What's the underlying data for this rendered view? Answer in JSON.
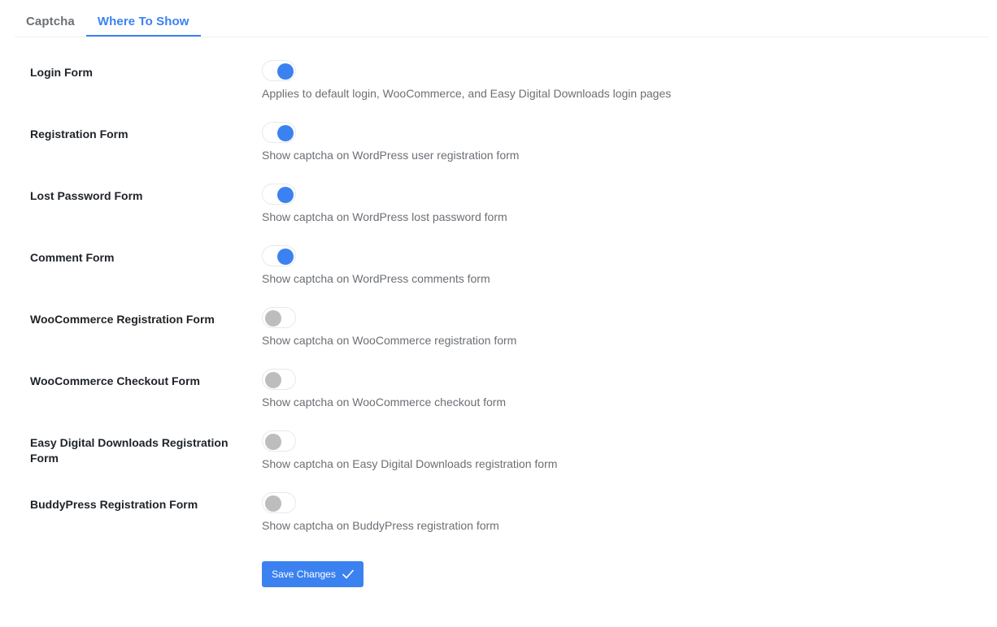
{
  "tabs": [
    {
      "label": "Captcha",
      "active": false
    },
    {
      "label": "Where To Show",
      "active": true
    }
  ],
  "settings": [
    {
      "label": "Login Form",
      "enabled": true,
      "description": "Applies to default login, WooCommerce, and Easy Digital Downloads login pages"
    },
    {
      "label": "Registration Form",
      "enabled": true,
      "description": "Show captcha on WordPress user registration form"
    },
    {
      "label": "Lost Password Form",
      "enabled": true,
      "description": "Show captcha on WordPress lost password form"
    },
    {
      "label": "Comment Form",
      "enabled": true,
      "description": "Show captcha on WordPress comments form"
    },
    {
      "label": "WooCommerce Registration Form",
      "enabled": false,
      "description": "Show captcha on WooCommerce registration form"
    },
    {
      "label": "WooCommerce Checkout Form",
      "enabled": false,
      "description": "Show captcha on WooCommerce checkout form"
    },
    {
      "label": "Easy Digital Downloads Registration Form",
      "enabled": false,
      "description": "Show captcha on Easy Digital Downloads registration form"
    },
    {
      "label": "BuddyPress Registration Form",
      "enabled": false,
      "description": "Show captcha on BuddyPress registration form"
    }
  ],
  "save_button": {
    "label": "Save Changes",
    "icon": "check-icon"
  },
  "colors": {
    "accent": "#3b82f0",
    "toggle_off": "#bdbdbd",
    "description_text": "#6b6f74"
  }
}
